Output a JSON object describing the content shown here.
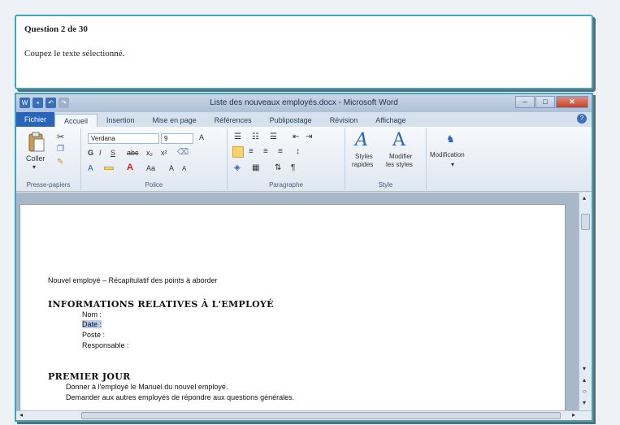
{
  "question": {
    "title": "Question 2 de 30",
    "text": "Coupez le texte sélectionné."
  },
  "window": {
    "title": "Liste des nouveaux employés.docx - Microsoft Word"
  },
  "tabs": [
    {
      "label": "Fichier"
    },
    {
      "label": "Accueil"
    },
    {
      "label": "Insertion"
    },
    {
      "label": "Mise en page"
    },
    {
      "label": "Références"
    },
    {
      "label": "Publipostage"
    },
    {
      "label": "Révision"
    },
    {
      "label": "Affichage"
    }
  ],
  "ribbon": {
    "clipboard": {
      "paste_label": "Coller",
      "group_label": "Presse-papiers"
    },
    "font": {
      "name": "Verdana",
      "size": "9",
      "group_label": "Police"
    },
    "paragraph": {
      "group_label": "Paragraphe"
    },
    "styles": {
      "quick_label1": "Styles",
      "quick_label2": "rapides",
      "change_label1": "Modifier",
      "change_label2": "les styles",
      "group_label": "Style"
    },
    "editing": {
      "label": "Modification"
    }
  },
  "document": {
    "intro": "Nouvel employé – Récapitulatif des points à aborder",
    "section1_heading": "INFORMATIONS RELATIVES À L'EMPLOYÉ",
    "fields": [
      "Nom :",
      "Date :",
      "Poste :",
      "Responsable :"
    ],
    "section2_heading": "PREMIER JOUR",
    "day1_items": [
      "Donner à l'employé le Manuel du nouvel employé.",
      "Demander aux autres employés de répondre aux questions générales."
    ]
  },
  "colors": {
    "accent": "#3fa8b8",
    "file_tab": "#2a64b8",
    "selection": "#b8cdea"
  }
}
